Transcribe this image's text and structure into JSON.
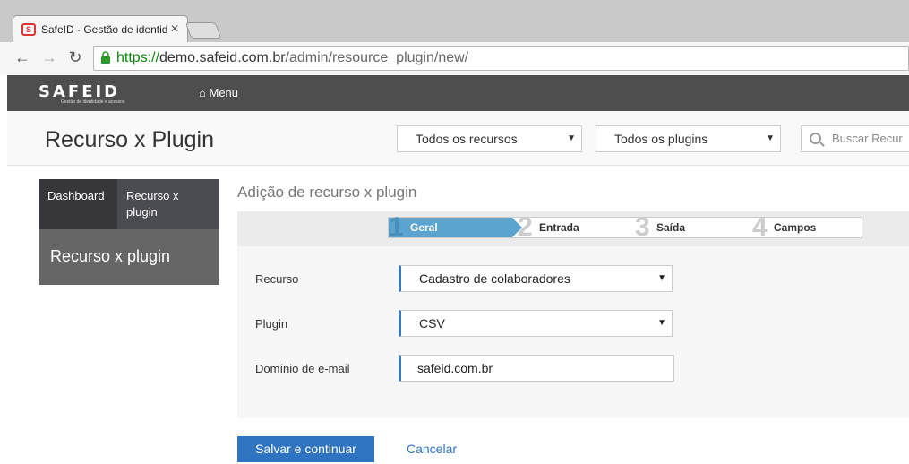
{
  "browser": {
    "tab_title": "SafeID - Gestão de identid",
    "url_scheme": "https://",
    "url_host": "demo.safeid.com.br",
    "url_path": "/admin/resource_plugin/new/"
  },
  "appbar": {
    "logo_text": "SAFEID",
    "logo_subtitle": "Gestão de identidade e acessos",
    "menu_label": "Menu"
  },
  "header": {
    "title": "Recurso x Plugin",
    "filter_resources": "Todos os recursos",
    "filter_plugins": "Todos os plugins",
    "search_placeholder": "Buscar Recur"
  },
  "sidebar": {
    "breadcrumbs": [
      "Dashboard",
      "Recurso x plugin"
    ],
    "current": "Recurso x plugin"
  },
  "main": {
    "section_title": "Adição de recurso x plugin",
    "steps": [
      {
        "num": "1",
        "label": "Geral"
      },
      {
        "num": "2",
        "label": "Entrada"
      },
      {
        "num": "3",
        "label": "Saída"
      },
      {
        "num": "4",
        "label": "Campos"
      }
    ],
    "form": {
      "resource_label": "Recurso",
      "resource_value": "Cadastro de colaboradores",
      "plugin_label": "Plugin",
      "plugin_value": "CSV",
      "email_domain_label": "Domínio de e-mail",
      "email_domain_value": "safeid.com.br"
    },
    "save_label": "Salvar e continuar",
    "cancel_label": "Cancelar"
  },
  "colors": {
    "accent": "#2f74c0",
    "step_active": "#5aa4cf",
    "appbar": "#4e4e4e"
  }
}
